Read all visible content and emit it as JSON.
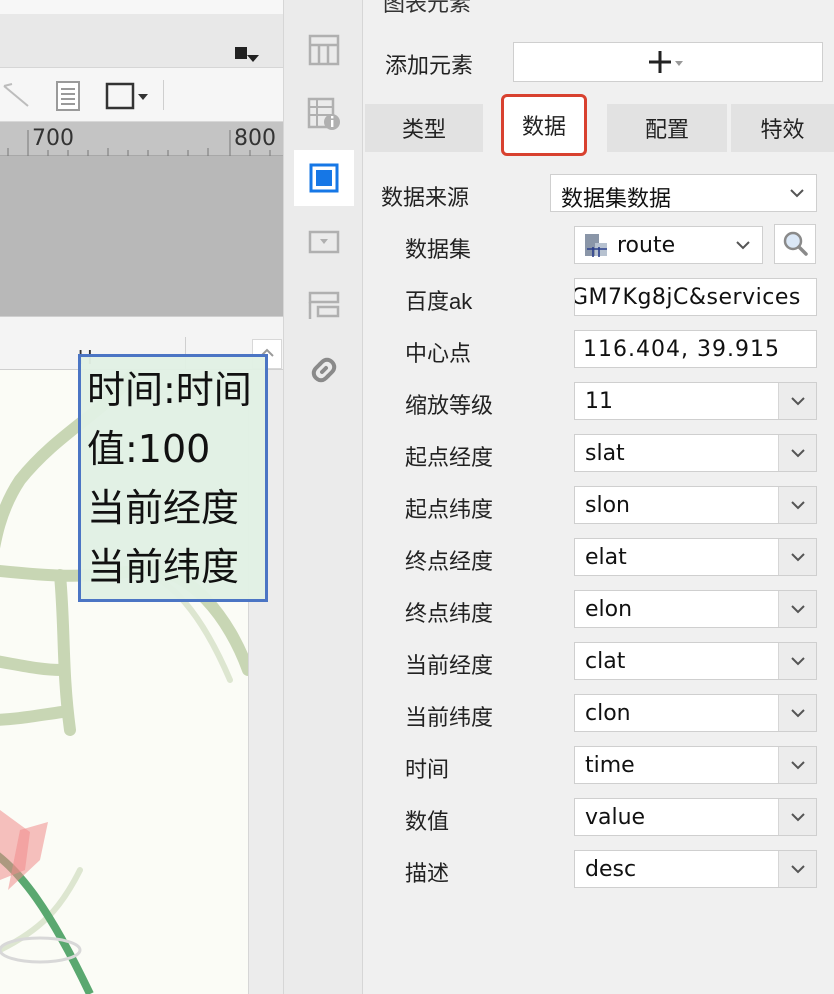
{
  "ruler": {
    "marks": [
      "700",
      "800"
    ]
  },
  "sheet": {
    "column_label": "H"
  },
  "tooltip": {
    "lines": [
      "时间:时间",
      "值:100",
      "当前经度",
      "当前纬度"
    ]
  },
  "panel": {
    "add_element_label": "添加元素",
    "add_button_glyph": "+",
    "tabs": [
      {
        "label": "类型",
        "active": false
      },
      {
        "label": "数据",
        "active": true
      },
      {
        "label": "配置",
        "active": false
      },
      {
        "label": "特效",
        "active": false
      }
    ],
    "data_source": {
      "label": "数据来源",
      "value": "数据集数据"
    },
    "dataset": {
      "label": "数据集",
      "value": "route"
    },
    "baidu_ak": {
      "label": "百度ak",
      "value": "GM7Kg8jC&services"
    },
    "center": {
      "label": "中心点",
      "value": "116.404, 39.915"
    },
    "fields": [
      {
        "label": "缩放等级",
        "value": "11"
      },
      {
        "label": "起点经度",
        "value": "slat"
      },
      {
        "label": "起点纬度",
        "value": "slon"
      },
      {
        "label": "终点经度",
        "value": "elat"
      },
      {
        "label": "终点纬度",
        "value": "elon"
      },
      {
        "label": "当前经度",
        "value": "clat"
      },
      {
        "label": "当前纬度",
        "value": "clon"
      },
      {
        "label": "时间",
        "value": "time"
      },
      {
        "label": "数值",
        "value": "value"
      },
      {
        "label": "描述",
        "value": "desc"
      }
    ]
  },
  "colors": {
    "active_tab_border": "#d8412f",
    "active_icon": "#1677e6",
    "tooltip_border": "#4b75c4",
    "map_road": "#c8d6b4",
    "route_line": "#5aa870",
    "heat_marker": "#f08c8c"
  },
  "icons": {
    "side": [
      "report-layout-icon",
      "cell-info-icon",
      "chart-frame-icon",
      "dropdown-widget-icon",
      "form-widget-icon",
      "hyperlink-icon"
    ],
    "toolbar": [
      "line-tool-icon",
      "document-icon",
      "frame-select-icon"
    ]
  }
}
